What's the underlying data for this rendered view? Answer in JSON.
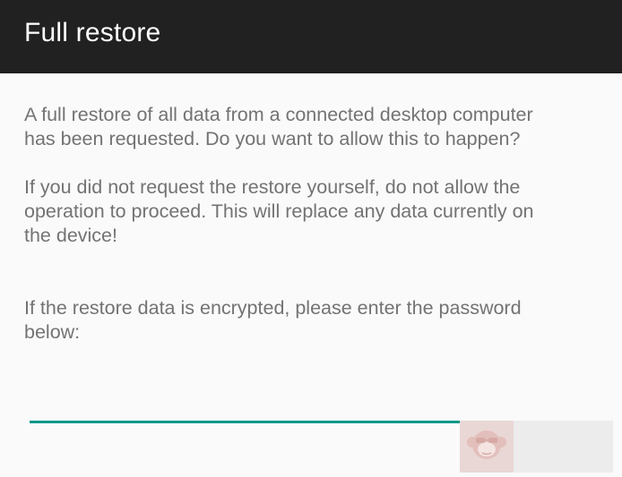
{
  "header": {
    "title": "Full restore"
  },
  "body": {
    "paragraph_1": "A full restore of all data from a connected desktop computer\nhas been requested. Do you want to allow this to happen?",
    "paragraph_2": "If you did not request the restore yourself, do not allow the\noperation to proceed. This will replace any data currently on\nthe device!",
    "paragraph_3": "If the restore data is encrypted, please enter the password\nbelow:"
  },
  "password_input": {
    "value": "",
    "placeholder": ""
  },
  "colors": {
    "app_bar": "#212121",
    "accent": "#009688",
    "body_text": "#737373",
    "background": "#fafafa"
  },
  "icons": {
    "watermark": "monkey-face-icon"
  }
}
